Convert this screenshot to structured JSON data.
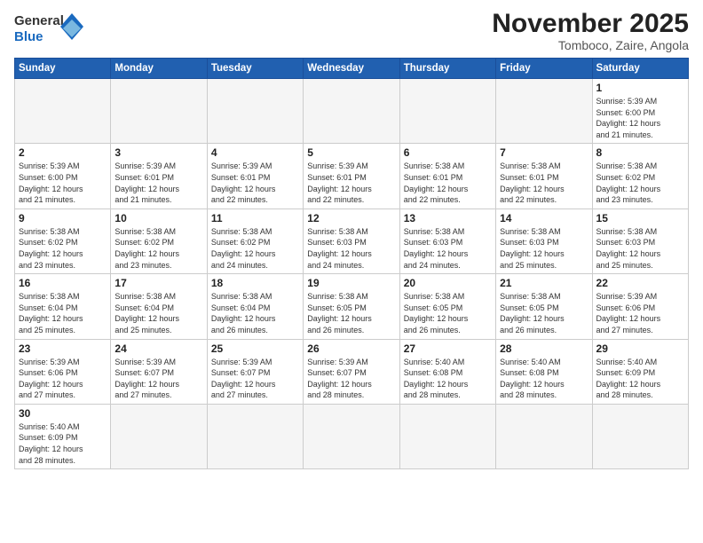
{
  "header": {
    "logo_general": "General",
    "logo_blue": "Blue",
    "title": "November 2025",
    "subtitle": "Tomboco, Zaire, Angola"
  },
  "calendar": {
    "days_of_week": [
      "Sunday",
      "Monday",
      "Tuesday",
      "Wednesday",
      "Thursday",
      "Friday",
      "Saturday"
    ],
    "weeks": [
      [
        {
          "day": "",
          "info": ""
        },
        {
          "day": "",
          "info": ""
        },
        {
          "day": "",
          "info": ""
        },
        {
          "day": "",
          "info": ""
        },
        {
          "day": "",
          "info": ""
        },
        {
          "day": "",
          "info": ""
        },
        {
          "day": "1",
          "info": "Sunrise: 5:39 AM\nSunset: 6:00 PM\nDaylight: 12 hours\nand 21 minutes."
        }
      ],
      [
        {
          "day": "2",
          "info": "Sunrise: 5:39 AM\nSunset: 6:00 PM\nDaylight: 12 hours\nand 21 minutes."
        },
        {
          "day": "3",
          "info": "Sunrise: 5:39 AM\nSunset: 6:01 PM\nDaylight: 12 hours\nand 21 minutes."
        },
        {
          "day": "4",
          "info": "Sunrise: 5:39 AM\nSunset: 6:01 PM\nDaylight: 12 hours\nand 22 minutes."
        },
        {
          "day": "5",
          "info": "Sunrise: 5:39 AM\nSunset: 6:01 PM\nDaylight: 12 hours\nand 22 minutes."
        },
        {
          "day": "6",
          "info": "Sunrise: 5:38 AM\nSunset: 6:01 PM\nDaylight: 12 hours\nand 22 minutes."
        },
        {
          "day": "7",
          "info": "Sunrise: 5:38 AM\nSunset: 6:01 PM\nDaylight: 12 hours\nand 22 minutes."
        },
        {
          "day": "8",
          "info": "Sunrise: 5:38 AM\nSunset: 6:02 PM\nDaylight: 12 hours\nand 23 minutes."
        }
      ],
      [
        {
          "day": "9",
          "info": "Sunrise: 5:38 AM\nSunset: 6:02 PM\nDaylight: 12 hours\nand 23 minutes."
        },
        {
          "day": "10",
          "info": "Sunrise: 5:38 AM\nSunset: 6:02 PM\nDaylight: 12 hours\nand 23 minutes."
        },
        {
          "day": "11",
          "info": "Sunrise: 5:38 AM\nSunset: 6:02 PM\nDaylight: 12 hours\nand 24 minutes."
        },
        {
          "day": "12",
          "info": "Sunrise: 5:38 AM\nSunset: 6:03 PM\nDaylight: 12 hours\nand 24 minutes."
        },
        {
          "day": "13",
          "info": "Sunrise: 5:38 AM\nSunset: 6:03 PM\nDaylight: 12 hours\nand 24 minutes."
        },
        {
          "day": "14",
          "info": "Sunrise: 5:38 AM\nSunset: 6:03 PM\nDaylight: 12 hours\nand 25 minutes."
        },
        {
          "day": "15",
          "info": "Sunrise: 5:38 AM\nSunset: 6:03 PM\nDaylight: 12 hours\nand 25 minutes."
        }
      ],
      [
        {
          "day": "16",
          "info": "Sunrise: 5:38 AM\nSunset: 6:04 PM\nDaylight: 12 hours\nand 25 minutes."
        },
        {
          "day": "17",
          "info": "Sunrise: 5:38 AM\nSunset: 6:04 PM\nDaylight: 12 hours\nand 25 minutes."
        },
        {
          "day": "18",
          "info": "Sunrise: 5:38 AM\nSunset: 6:04 PM\nDaylight: 12 hours\nand 26 minutes."
        },
        {
          "day": "19",
          "info": "Sunrise: 5:38 AM\nSunset: 6:05 PM\nDaylight: 12 hours\nand 26 minutes."
        },
        {
          "day": "20",
          "info": "Sunrise: 5:38 AM\nSunset: 6:05 PM\nDaylight: 12 hours\nand 26 minutes."
        },
        {
          "day": "21",
          "info": "Sunrise: 5:38 AM\nSunset: 6:05 PM\nDaylight: 12 hours\nand 26 minutes."
        },
        {
          "day": "22",
          "info": "Sunrise: 5:39 AM\nSunset: 6:06 PM\nDaylight: 12 hours\nand 27 minutes."
        }
      ],
      [
        {
          "day": "23",
          "info": "Sunrise: 5:39 AM\nSunset: 6:06 PM\nDaylight: 12 hours\nand 27 minutes."
        },
        {
          "day": "24",
          "info": "Sunrise: 5:39 AM\nSunset: 6:07 PM\nDaylight: 12 hours\nand 27 minutes."
        },
        {
          "day": "25",
          "info": "Sunrise: 5:39 AM\nSunset: 6:07 PM\nDaylight: 12 hours\nand 27 minutes."
        },
        {
          "day": "26",
          "info": "Sunrise: 5:39 AM\nSunset: 6:07 PM\nDaylight: 12 hours\nand 28 minutes."
        },
        {
          "day": "27",
          "info": "Sunrise: 5:40 AM\nSunset: 6:08 PM\nDaylight: 12 hours\nand 28 minutes."
        },
        {
          "day": "28",
          "info": "Sunrise: 5:40 AM\nSunset: 6:08 PM\nDaylight: 12 hours\nand 28 minutes."
        },
        {
          "day": "29",
          "info": "Sunrise: 5:40 AM\nSunset: 6:09 PM\nDaylight: 12 hours\nand 28 minutes."
        }
      ],
      [
        {
          "day": "30",
          "info": "Sunrise: 5:40 AM\nSunset: 6:09 PM\nDaylight: 12 hours\nand 28 minutes."
        },
        {
          "day": "",
          "info": ""
        },
        {
          "day": "",
          "info": ""
        },
        {
          "day": "",
          "info": ""
        },
        {
          "day": "",
          "info": ""
        },
        {
          "day": "",
          "info": ""
        },
        {
          "day": "",
          "info": ""
        }
      ]
    ]
  }
}
